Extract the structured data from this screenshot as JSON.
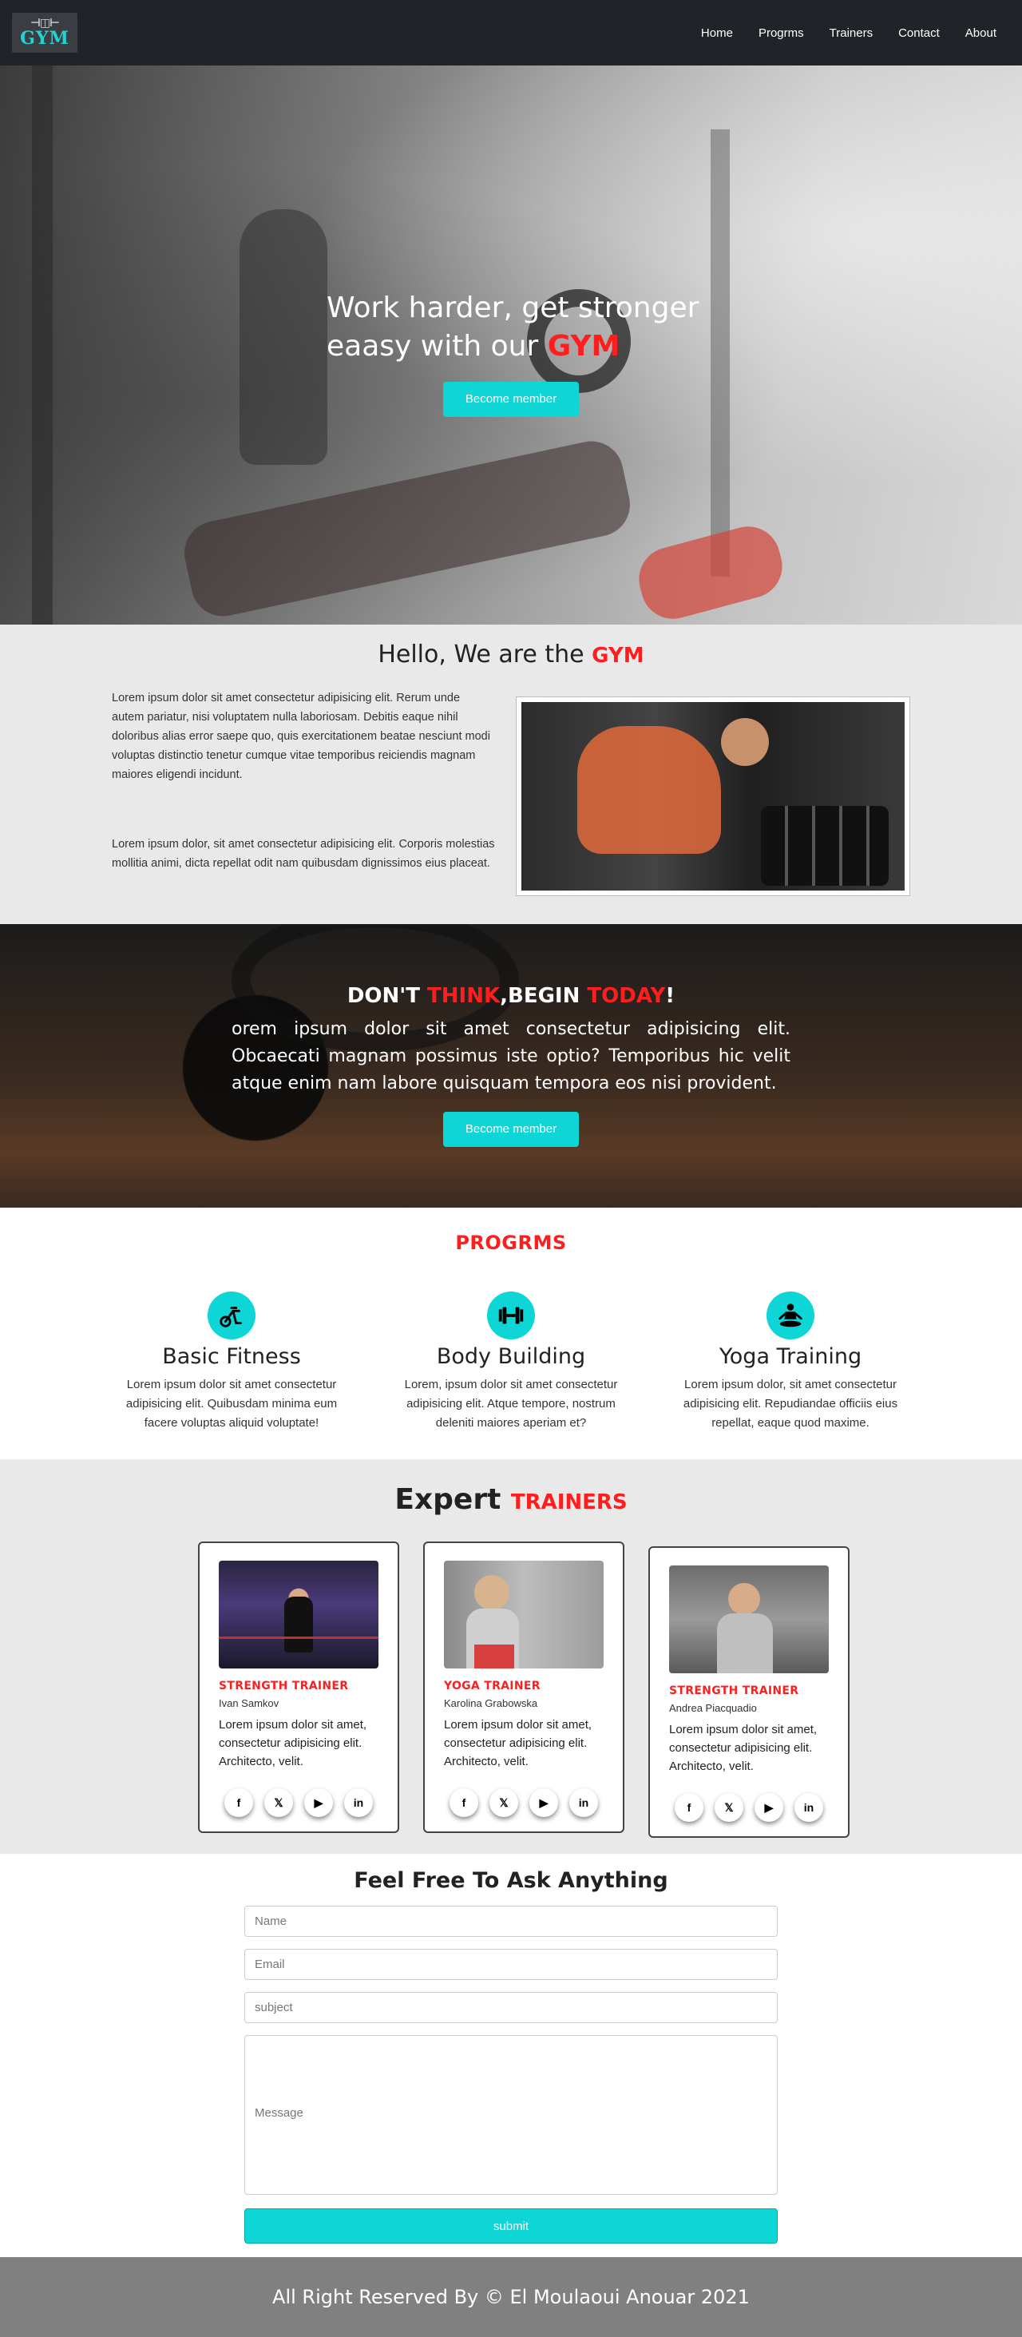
{
  "nav": {
    "logo_text": "GYM",
    "links": [
      "Home",
      "Progrms",
      "Trainers",
      "Contact",
      "About"
    ]
  },
  "hero": {
    "title_line1": "Work harder, get stronger",
    "title_line2_prefix": "eaasy with our ",
    "title_accent": "GYM",
    "button": "Become member"
  },
  "about": {
    "title_prefix": "Hello, We are the ",
    "title_accent": "GYM",
    "paragraph1": "Lorem ipsum dolor sit amet consectetur adipisicing elit. Rerum unde autem pariatur, nisi voluptatem nulla laboriosam. Debitis eaque nihil doloribus alias error saepe quo, quis exercitationem beatae nesciunt modi voluptas distinctio tenetur cumque vitae temporibus reiciendis magnam maiores eligendi incidunt.",
    "paragraph2": "Lorem ipsum dolor, sit amet consectetur adipisicing elit. Corporis molestias mollitia animi, dicta repellat odit nam quibusdam dignissimos eius placeat."
  },
  "think": {
    "part1": "DON'T ",
    "accent1": "THINK",
    "part2": ",BEGIN ",
    "accent2": "TODAY",
    "part3": "!",
    "text": "orem ipsum dolor sit amet consectetur adipisicing elit. Obcaecati magnam possimus iste optio? Temporibus hic velit atque enim nam labore quisquam tempora eos nisi provident.",
    "button": "Become member"
  },
  "programs": {
    "title": "PROGRMS",
    "items": [
      {
        "icon": "exercise-bike-icon",
        "name": "Basic Fitness",
        "desc": "Lorem ipsum dolor sit amet consectetur adipisicing elit. Quibusdam minima eum facere voluptas aliquid voluptate!"
      },
      {
        "icon": "dumbbell-icon",
        "name": "Body Building",
        "desc": "Lorem, ipsum dolor sit amet consectetur adipisicing elit. Atque tempore, nostrum deleniti maiores aperiam et?"
      },
      {
        "icon": "meditation-icon",
        "name": "Yoga Training",
        "desc": "Lorem ipsum dolor, sit amet consectetur adipisicing elit. Repudiandae officiis eius repellat, eaque quod maxime."
      }
    ]
  },
  "trainers": {
    "title_prefix": "Expert ",
    "title_accent": "TRAINERS",
    "cards": [
      {
        "role": "STRENGTH TRAINER",
        "name": "Ivan Samkov",
        "desc": "Lorem ipsum dolor sit amet, consectetur adipisicing elit. Architecto, velit."
      },
      {
        "role": "YOGA TRAINER",
        "name": "Karolina Grabowska",
        "desc": "Lorem ipsum dolor sit amet, consectetur adipisicing elit. Architecto, velit."
      },
      {
        "role": "STRENGTH TRAINER",
        "name": "Andrea Piacquadio",
        "desc": "Lorem ipsum dolor sit amet, consectetur adipisicing elit. Architecto, velit."
      }
    ],
    "social": {
      "facebook": "f",
      "twitter": "𝕏",
      "youtube": "▶",
      "linkedin": "in"
    }
  },
  "contact": {
    "title": "Feel Free To Ask Anything",
    "name_placeholder": "Name",
    "email_placeholder": "Email",
    "subject_placeholder": "subject",
    "message_placeholder": "Message",
    "submit": "submit"
  },
  "footer": {
    "text": "All Right Reserved By © El Moulaoui Anouar 2021"
  },
  "colors": {
    "accent": "#0fd6d6",
    "highlight": "#ff1e1e",
    "nav_bg": "#202327",
    "section_gray": "#e9e9e9",
    "footer_bg": "#808080"
  }
}
